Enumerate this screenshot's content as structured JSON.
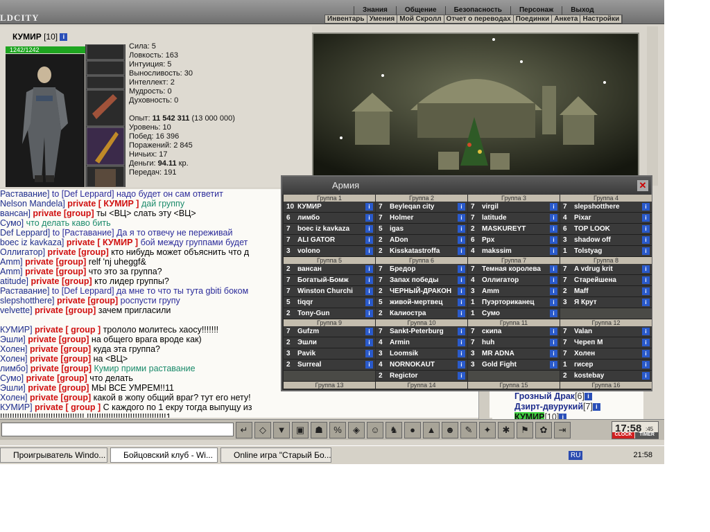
{
  "header": {
    "logo": "LDCITY",
    "menu": [
      "Знания",
      "Общение",
      "Безопасность",
      "Персонаж",
      "Выход"
    ],
    "submenu": [
      "Инвентарь",
      "Умения",
      "Мой Скролл",
      "Отчет о переводах",
      "Поединки",
      "Анкета",
      "Настройки"
    ]
  },
  "character": {
    "name": "КУМИР",
    "level": "[10]",
    "hp": "1242/1242",
    "stats": [
      "Сила: 5",
      "Ловкость: 163",
      "Интуиция: 5",
      "Выносливость: 30",
      "Интеллект: 2",
      "Мудрость: 0",
      "Духовность: 0"
    ],
    "exp_label": "Опыт:",
    "exp_value": "11 542 311",
    "exp_next": "(13 000 000)",
    "extra": [
      "Уровень: 10",
      "Побед: 16 396",
      "Поражений: 2 845",
      "Ничьих: 17"
    ],
    "money_label": "Деньги:",
    "money_value": "94.11",
    "money_unit": "кр.",
    "transfers": "Передач: 191"
  },
  "chat": {
    "lines": [
      [
        {
          "c": "n",
          "t": "Раставание]"
        },
        {
          "c": "t",
          "t": " to [Def Leppard] надо будет он сам ответит"
        }
      ],
      [
        {
          "c": "n",
          "t": "Nelson Mandela]"
        },
        {
          "c": "p",
          "t": " private [ КУМИР ]"
        },
        {
          "c": "g",
          "t": " дай группу"
        }
      ],
      [
        {
          "c": "n",
          "t": "вансан]"
        },
        {
          "c": "p",
          "t": " private [group]"
        },
        {
          "c": "m",
          "t": " ты <ВЦ> слать эту <ВЦ>"
        }
      ],
      [
        {
          "c": "n",
          "t": "Сумо]"
        },
        {
          "c": "g",
          "t": " что делать каво бить"
        }
      ],
      [
        {
          "c": "n",
          "t": "Def Leppard]"
        },
        {
          "c": "t",
          "t": " to [Раставание] Да я то отвечу не переживай"
        }
      ],
      [
        {
          "c": "n",
          "t": "boec iz kavkaza]"
        },
        {
          "c": "p",
          "t": " private [ КУМИР ]"
        },
        {
          "c": "t",
          "t": " бой между группами будет"
        }
      ],
      [
        {
          "c": "n",
          "t": "Оллигатор]"
        },
        {
          "c": "p",
          "t": " private [group]"
        },
        {
          "c": "m",
          "t": " кто нибудь может объяснить что д"
        }
      ],
      [
        {
          "c": "n",
          "t": "Amm]"
        },
        {
          "c": "p",
          "t": " private [group]"
        },
        {
          "c": "m",
          "t": " relf 'nj uheggf&"
        }
      ],
      [
        {
          "c": "n",
          "t": "Amm]"
        },
        {
          "c": "p",
          "t": " private [group]"
        },
        {
          "c": "m",
          "t": " что это за группа?"
        }
      ],
      [
        {
          "c": "n",
          "t": "atitude]"
        },
        {
          "c": "p",
          "t": " private [group]"
        },
        {
          "c": "m",
          "t": " кто лидер группы?"
        }
      ],
      [
        {
          "c": "n",
          "t": "Раставание]"
        },
        {
          "c": "t",
          "t": " to [Def Leppard] да мне то что ты тута gbiti боком"
        }
      ],
      [
        {
          "c": "n",
          "t": "slepshotthere]"
        },
        {
          "c": "p",
          "t": " private [group]"
        },
        {
          "c": "t",
          "t": " роспусти групу"
        }
      ],
      [
        {
          "c": "n",
          "t": "velvette]"
        },
        {
          "c": "p",
          "t": " private [group]"
        },
        {
          "c": "m",
          "t": " зачем пригласили"
        }
      ],
      [
        {
          "c": "m",
          "t": " "
        }
      ],
      [
        {
          "c": "n",
          "t": "КУМИР]"
        },
        {
          "c": "p",
          "t": " private [ group ]"
        },
        {
          "c": "m",
          "t": " трололо        молитесь хаосу!!!!!!!"
        }
      ],
      [
        {
          "c": "n",
          "t": "Эшли]"
        },
        {
          "c": "p",
          "t": " private [group]"
        },
        {
          "c": "m",
          "t": " на общего врага вроде как)"
        }
      ],
      [
        {
          "c": "n",
          "t": "Холен]"
        },
        {
          "c": "p",
          "t": " private [group]"
        },
        {
          "c": "m",
          "t": " куда эта группа?"
        }
      ],
      [
        {
          "c": "n",
          "t": "Холен]"
        },
        {
          "c": "p",
          "t": " private [group]"
        },
        {
          "c": "m",
          "t": " на <ВЦ>"
        }
      ],
      [
        {
          "c": "n",
          "t": "лимбо]"
        },
        {
          "c": "p",
          "t": " private [group]"
        },
        {
          "c": "g",
          "t": " Кумир прими раставание"
        }
      ],
      [
        {
          "c": "n",
          "t": "Сумо]"
        },
        {
          "c": "p",
          "t": " private [group]"
        },
        {
          "c": "m",
          "t": " что делать"
        }
      ],
      [
        {
          "c": "n",
          "t": "Эшли]"
        },
        {
          "c": "p",
          "t": " private [group]"
        },
        {
          "c": "m",
          "t": " МЫ ВСЕ УМРЕМ!!11"
        }
      ],
      [
        {
          "c": "n",
          "t": "Холен]"
        },
        {
          "c": "p",
          "t": " private [group]"
        },
        {
          "c": "m",
          "t": " какой в жопу общий враг? тут его нету!"
        }
      ],
      [
        {
          "c": "n",
          "t": "КУМИР]"
        },
        {
          "c": "p",
          "t": " private [ group ]"
        },
        {
          "c": "m",
          "t": " С каждого по 1 екру тогда выпущу из"
        }
      ],
      [
        {
          "c": "m",
          "t": "!!!!!!!!!!!!!!!!!!!!!!!!!!!!!!!!!!! !!!!!!!!!!!!!!!!!!!!!!!!!!!!!!!!!1"
        }
      ]
    ]
  },
  "online": {
    "users": [
      {
        "name": "Грозный Драк",
        "level": "[6]"
      },
      {
        "name": "Дзирт-двурукий",
        "level": "[7]"
      },
      {
        "name": "КУМИР",
        "level": "[10]"
      }
    ]
  },
  "clock": {
    "time": "17:58",
    "sec": ":45",
    "left": "CLOCK",
    "right": "TIMER"
  },
  "army": {
    "title": "Армия",
    "rows": [
      {
        "groups": [
          {
            "title": "Группа 1",
            "members": [
              [
                "10",
                "КУМИР"
              ],
              [
                "6",
                "лимбо"
              ],
              [
                "7",
                "boec iz kavkaza"
              ],
              [
                "7",
                "ALI GATOR"
              ],
              [
                "3",
                "volono"
              ]
            ]
          },
          {
            "title": "Группа 2",
            "members": [
              [
                "7",
                "Beyleqan city"
              ],
              [
                "7",
                "Holmer"
              ],
              [
                "5",
                "igas"
              ],
              [
                "2",
                "ADon"
              ],
              [
                "2",
                "Kisskatastroffa"
              ]
            ]
          },
          {
            "title": "Группа 3",
            "members": [
              [
                "7",
                "virgil"
              ],
              [
                "7",
                "latitude"
              ],
              [
                "2",
                "MASKUREYT"
              ],
              [
                "6",
                "Ppx"
              ],
              [
                "4",
                "makssim"
              ]
            ]
          },
          {
            "title": "Группа 4",
            "members": [
              [
                "7",
                "slepshotthere"
              ],
              [
                "4",
                "Pixar"
              ],
              [
                "6",
                "TOP LOOK"
              ],
              [
                "3",
                "shadow off"
              ],
              [
                "1",
                "Tolstyag"
              ]
            ]
          }
        ]
      },
      {
        "groups": [
          {
            "title": "Группа 5",
            "members": [
              [
                "2",
                "вансан"
              ],
              [
                "7",
                "Богатый-Бомж"
              ],
              [
                "7",
                "Winston Churchi"
              ],
              [
                "5",
                "tiqqr"
              ],
              [
                "2",
                "Tony-Gun"
              ]
            ]
          },
          {
            "title": "Группа 6",
            "members": [
              [
                "7",
                "Бредор"
              ],
              [
                "7",
                "Запах победы"
              ],
              [
                "2",
                "ЧЕРНЫЙ-ДРАКОН"
              ],
              [
                "5",
                "живой-мертвец"
              ],
              [
                "2",
                "Калиостра"
              ]
            ]
          },
          {
            "title": "Группа 7",
            "members": [
              [
                "7",
                "Темная королева"
              ],
              [
                "4",
                "Оллигатор"
              ],
              [
                "3",
                "Amm"
              ],
              [
                "1",
                "Пуэрториканец"
              ],
              [
                "1",
                "Сумо"
              ]
            ]
          },
          {
            "title": "Группа 8",
            "members": [
              [
                "7",
                "A vdrug krit"
              ],
              [
                "7",
                "Старейшена"
              ],
              [
                "2",
                "Maff"
              ],
              [
                "3",
                "Я Крут"
              ],
              [
                "",
                ""
              ]
            ]
          }
        ]
      },
      {
        "groups": [
          {
            "title": "Группа 9",
            "members": [
              [
                "7",
                "Gufzm"
              ],
              [
                "2",
                "Эшли"
              ],
              [
                "3",
                "Pavik"
              ],
              [
                "2",
                "Surreal"
              ],
              [
                "",
                ""
              ]
            ]
          },
          {
            "title": "Группа 10",
            "members": [
              [
                "7",
                "Sankt-Peterburg"
              ],
              [
                "4",
                "Armin"
              ],
              [
                "3",
                "Loomsik"
              ],
              [
                "4",
                "NORNOKAUT"
              ],
              [
                "2",
                "Regictor"
              ]
            ]
          },
          {
            "title": "Группа 11",
            "members": [
              [
                "7",
                "скипа"
              ],
              [
                "7",
                "huh"
              ],
              [
                "3",
                "MR ADNA"
              ],
              [
                "3",
                "Gold Fight"
              ],
              [
                "",
                ""
              ]
            ]
          },
          {
            "title": "Группа 12",
            "members": [
              [
                "7",
                "Valan"
              ],
              [
                "7",
                "Череп М"
              ],
              [
                "7",
                "Холен"
              ],
              [
                "1",
                "гисер"
              ],
              [
                "2",
                "kostebay"
              ]
            ]
          }
        ]
      },
      {
        "groups": [
          {
            "title": "Группа 13",
            "members": []
          },
          {
            "title": "Группа 14",
            "members": []
          },
          {
            "title": "Группа 15",
            "members": []
          },
          {
            "title": "Группа 16",
            "members": []
          }
        ]
      }
    ]
  },
  "taskbar": {
    "tasks": [
      "Проигрыватель Windo...",
      "Бойцовский клуб - Wi...",
      "Online игра \"Старый Бо..."
    ],
    "lang": "RU",
    "time": "21:58"
  }
}
